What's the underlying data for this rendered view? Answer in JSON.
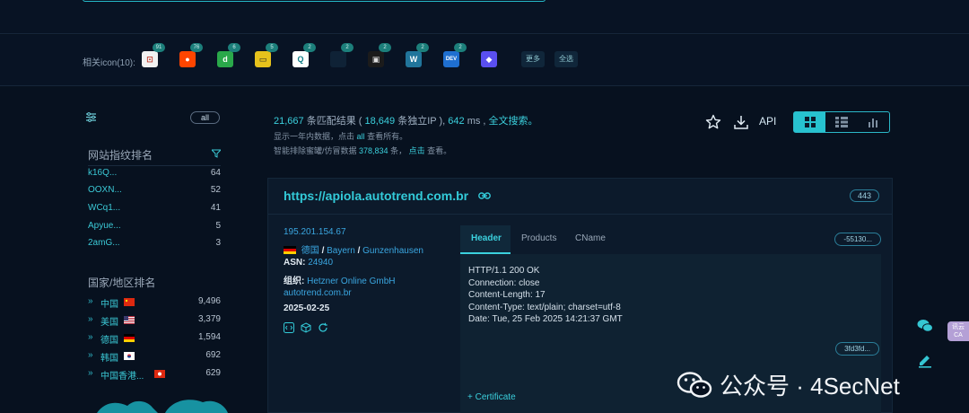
{
  "icon_row": {
    "label": "相关icon(10):",
    "icons": [
      {
        "name": "icon-1",
        "glyph": "⊡",
        "bg": "#f1f1f1",
        "fg": "#c03a2b",
        "badge": "91"
      },
      {
        "name": "reddit-icon",
        "glyph": "●",
        "bg": "#ff4500",
        "fg": "#ffffff",
        "badge": "76"
      },
      {
        "name": "icon-3",
        "glyph": "d",
        "bg": "#2aa84a",
        "fg": "#ffffff",
        "badge": "6"
      },
      {
        "name": "icon-4",
        "glyph": "▭",
        "bg": "#e6c21c",
        "fg": "#222",
        "badge": "5"
      },
      {
        "name": "icon-5",
        "glyph": "Q",
        "bg": "#ffffff",
        "fg": "#0e7c86",
        "badge": "2"
      },
      {
        "name": "icon-6",
        "glyph": "",
        "bg": "#0f2236",
        "fg": "#0f2236",
        "badge": "2"
      },
      {
        "name": "icon-7",
        "glyph": "▣",
        "bg": "#1b1b1b",
        "fg": "#dddddd",
        "badge": "2"
      },
      {
        "name": "wordpress-icon",
        "glyph": "W",
        "bg": "#21759b",
        "fg": "#ffffff",
        "badge": "2"
      },
      {
        "name": "dev-icon",
        "glyph": "DEV",
        "bg": "#1f6fd0",
        "fg": "#ffffff",
        "badge": "2"
      },
      {
        "name": "icon-10",
        "glyph": "◆",
        "bg": "#5a4ff0",
        "fg": "#ffffff",
        "badge": ""
      }
    ],
    "more_label": "更多",
    "select_all_label": "全选"
  },
  "sidebar": {
    "all_label": "all",
    "fingerprint_title": "网站指纹排名",
    "fingerprints": [
      {
        "name": "k16Q...",
        "count": "64"
      },
      {
        "name": "OOXN...",
        "count": "52"
      },
      {
        "name": "WCq1...",
        "count": "41"
      },
      {
        "name": "Apyue...",
        "count": "5"
      },
      {
        "name": "2amG...",
        "count": "3"
      }
    ],
    "country_title": "国家/地区排名",
    "countries": [
      {
        "name": "中国",
        "count": "9,496"
      },
      {
        "name": "美国",
        "count": "3,379"
      },
      {
        "name": "德国",
        "count": "1,594"
      },
      {
        "name": "韩国",
        "count": "692"
      },
      {
        "name": "中国香港...",
        "count": "629"
      }
    ]
  },
  "stats": {
    "results": "21,667",
    "results_text": "条匹配结果 (",
    "ips": "18,649",
    "ips_text": "条独立IP ),",
    "ms": "642",
    "ms_text": "ms ,",
    "fulltext": "全文搜索。",
    "line2_a": "显示一年内数据，点击",
    "line2_all": "all",
    "line2_b": "查看所有。",
    "line3_a": "智能排除蜜罐/仿冒数据",
    "line3_num": "378,834",
    "line3_b": "条，",
    "line3_click": "点击",
    "line3_c": "查看。"
  },
  "toolbar": {
    "api_label": "API"
  },
  "result": {
    "url": "https://apiola.autotrend.com.br",
    "port": "443",
    "ip": "195.201.154.67",
    "country": "德国",
    "sep1": "/",
    "region": "Bayern",
    "sep2": "/",
    "city": "Gunzenhausen",
    "asn_label": "ASN:",
    "asn": "24940",
    "org_label": "组织:",
    "org": "Hetzner Online GmbH",
    "domain": "autotrend.com.br",
    "date": "2025-02-25",
    "tabs": [
      "Header",
      "Products",
      "CName"
    ],
    "hash_pill": "-55130...",
    "header_body": "HTTP/1.1 200 OK\nConnection: close\nContent-Length: 17\nContent-Type: text/plain; charset=utf-8\nDate: Tue, 25 Feb 2025 14:21:37 GMT",
    "certificate_label": "+ Certificate",
    "hash_pill2": "3fd3fd..."
  },
  "side": {
    "tag": "讯云 CA"
  },
  "watermark": {
    "text": "公众号 · 4SecNet"
  }
}
